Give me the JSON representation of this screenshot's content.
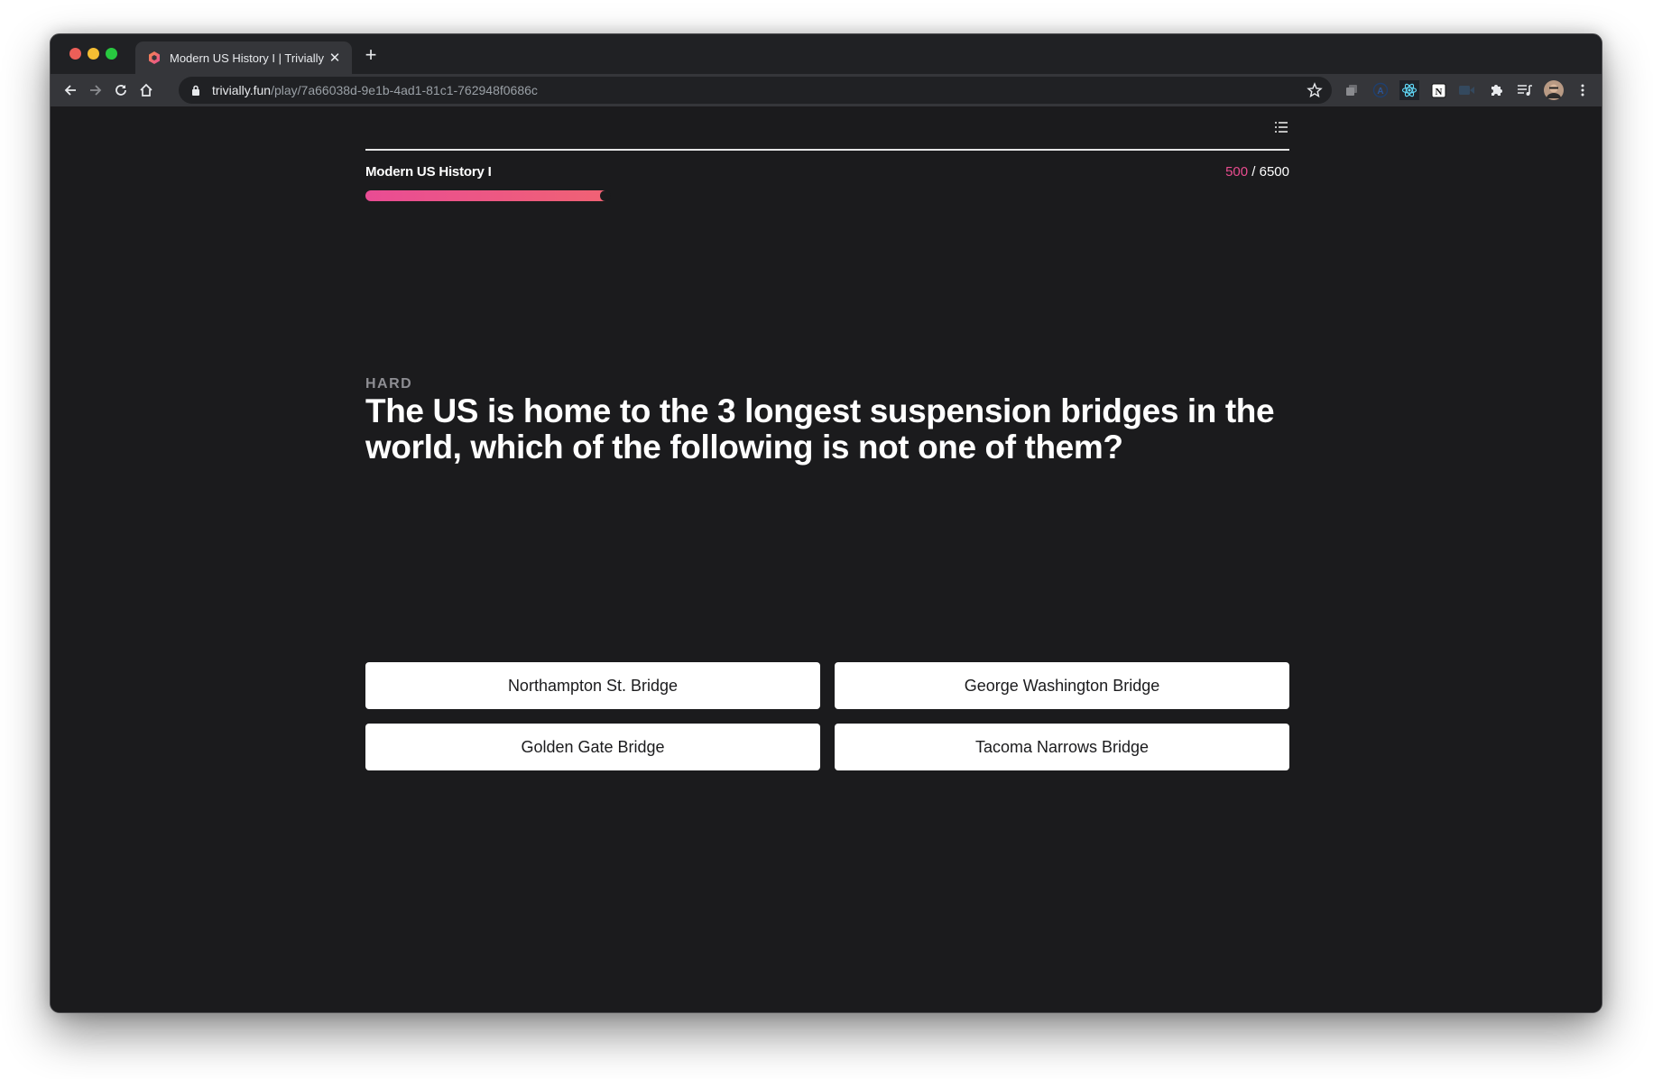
{
  "browser": {
    "tab": {
      "title": "Modern US History I | Trivially",
      "favicon": "hexagon-logo-icon"
    },
    "url": {
      "domain": "trivially.fun",
      "path": "/play/7a66038d-9e1b-4ad1-81c1-762948f0686c"
    },
    "nav_icons": [
      "back-icon",
      "forward-icon",
      "reload-icon",
      "home-icon"
    ],
    "extensions": [
      "tab-copy-icon",
      "a-circle-icon",
      "react-devtools-icon",
      "notion-icon",
      "video-camera-icon",
      "extensions-puzzle-icon",
      "media-queue-icon",
      "profile-avatar",
      "more-menu-icon"
    ]
  },
  "quiz": {
    "title": "Modern US History I",
    "score_current": "500",
    "score_separator": " / ",
    "score_total": "6500",
    "progress_fraction": 0.26,
    "difficulty": "HARD",
    "question": "The US is home to the 3 longest suspension bridges in the world, which of the following is not one of them?",
    "answers": [
      "Northampton St. Bridge",
      "George Washington Bridge",
      "Golden Gate Bridge",
      "Tacoma Narrows Bridge"
    ]
  },
  "colors": {
    "accent_pink": "#e94c8f",
    "progress_start": "#e94c94",
    "progress_end": "#f06274",
    "page_background": "#1b1b1d"
  }
}
